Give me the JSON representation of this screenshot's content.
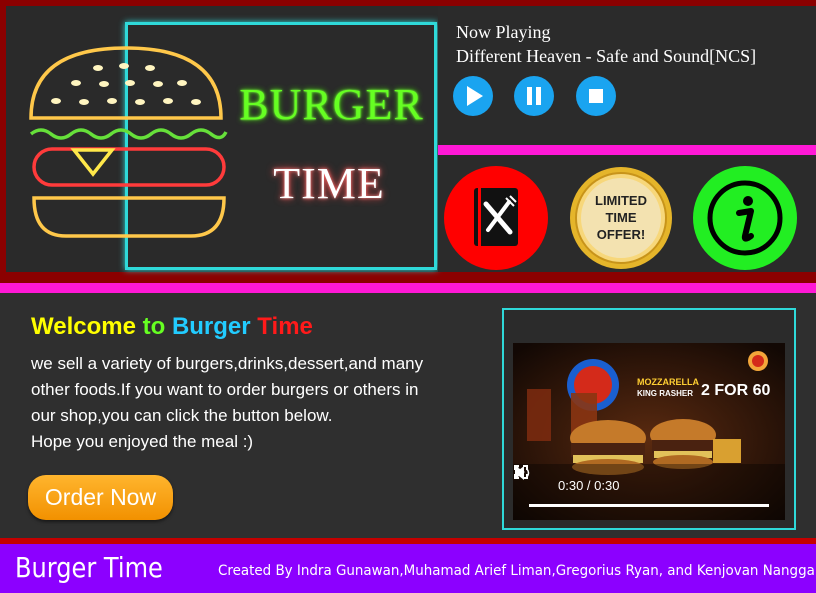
{
  "logo": {
    "word1": "BURGER",
    "word2": "TIME",
    "frame_color": "#2fd9d9",
    "burger_icon": "neon-burger-icon"
  },
  "player": {
    "label": "Now Playing",
    "track": "Different Heaven - Safe and Sound[NCS]",
    "buttons": [
      {
        "name": "play",
        "icon": "play-icon"
      },
      {
        "name": "pause",
        "icon": "pause-icon"
      },
      {
        "name": "stop",
        "icon": "stop-icon"
      }
    ],
    "button_color": "#1aa4f0"
  },
  "quick_links": [
    {
      "name": "menu",
      "icon": "menu-book-fork-knife-icon",
      "color": "#ff0000"
    },
    {
      "name": "offer",
      "badge_text": [
        "LIMITED",
        "TIME",
        "OFFER!"
      ],
      "color": "#f4c542"
    },
    {
      "name": "info",
      "icon": "info-icon",
      "color": "#22ee22"
    }
  ],
  "welcome": {
    "title_parts": [
      {
        "text": "Welcome ",
        "color": "#ffff00"
      },
      {
        "text": "to ",
        "color": "#66ff22"
      },
      {
        "text": "Burger ",
        "color": "#22ccff"
      },
      {
        "text": "Time",
        "color": "#ff1a1a"
      }
    ],
    "lines": [
      "we sell a variety of burgers,drinks,dessert,and many",
      "other foods.If you want to order burgers or others in",
      "our shop,you can click the button below.",
      "Hope you enjoyed the meal :)"
    ],
    "order_button": "Order Now"
  },
  "video": {
    "ad_line1": "MOZZARELLA",
    "ad_line2": "KING RASHER",
    "ad_price": "2 FOR 60",
    "time": "0:30 / 0:30",
    "progress": 1.0
  },
  "footer": {
    "brand": "Burger Time",
    "credits": "Created By Indra Gunawan,Muhamad Arief Liman,Gregorius Ryan, and Kenjovan Nanggala"
  },
  "colors": {
    "accent_magenta": "#ff18d6",
    "footer_purple": "#8c00ff",
    "border_red": "#c40000",
    "order_orange": "#f29100"
  }
}
